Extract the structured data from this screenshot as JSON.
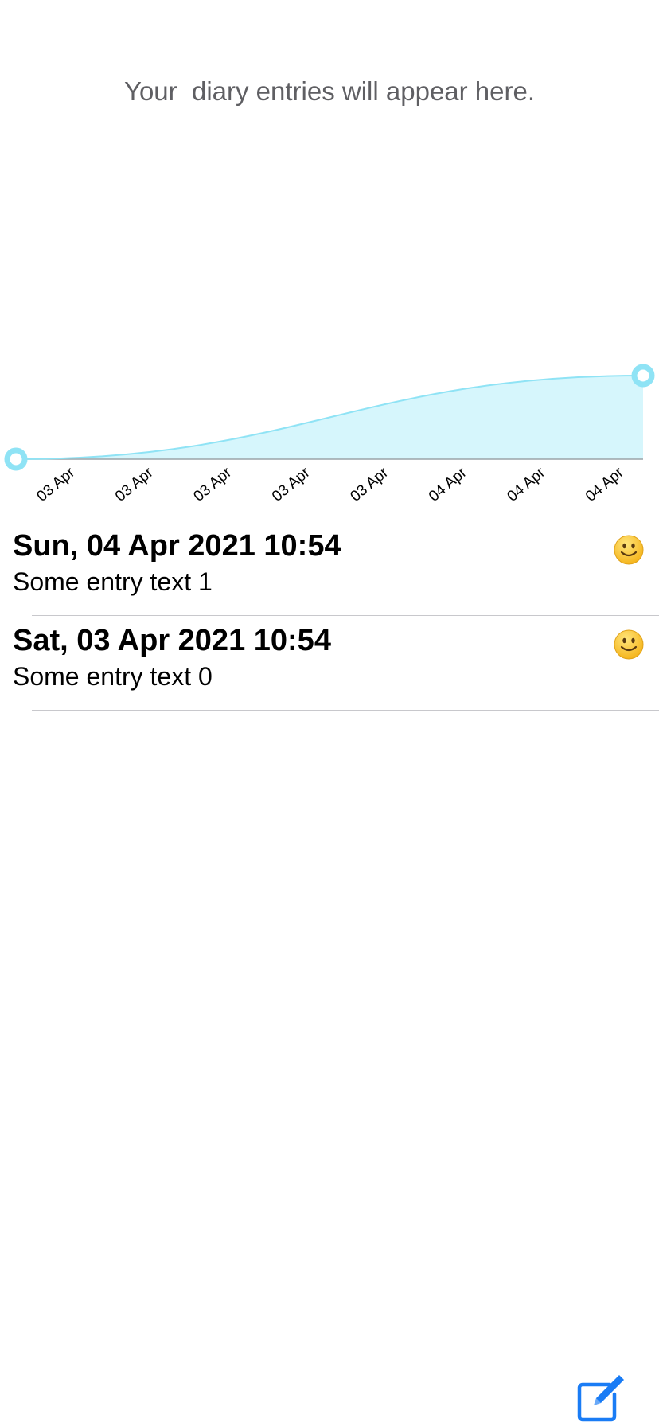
{
  "header": {
    "empty_message": "Your  diary entries will appear here."
  },
  "chart_data": {
    "type": "area",
    "x": [
      "03 Apr",
      "03 Apr",
      "03 Apr",
      "03 Apr",
      "03 Apr",
      "04 Apr",
      "04 Apr",
      "04 Apr"
    ],
    "series": [
      {
        "values": [
          0,
          1
        ]
      }
    ],
    "tick_labels": [
      "03 Apr",
      "03 Apr",
      "03 Apr",
      "03 Apr",
      "03 Apr",
      "04 Apr",
      "04 Apr",
      "04 Apr"
    ],
    "ylim": [
      0,
      1
    ],
    "grid": false,
    "legend": "none",
    "colors": {
      "line": "#8fe3f5",
      "fill": "#d6f6fc",
      "marker": "#8fe3f5",
      "baseline": "#9aa3a8"
    }
  },
  "entries": [
    {
      "date": "Sun, 04 Apr 2021 10:54",
      "text": "Some entry text 1",
      "mood": "slightly-smiling-face-icon"
    },
    {
      "date": "Sat, 03 Apr 2021 10:54",
      "text": "Some entry text 0",
      "mood": "slightly-smiling-face-icon"
    }
  ],
  "toolbar": {
    "compose_icon": "compose-icon",
    "accent": "#1a7cf5"
  }
}
